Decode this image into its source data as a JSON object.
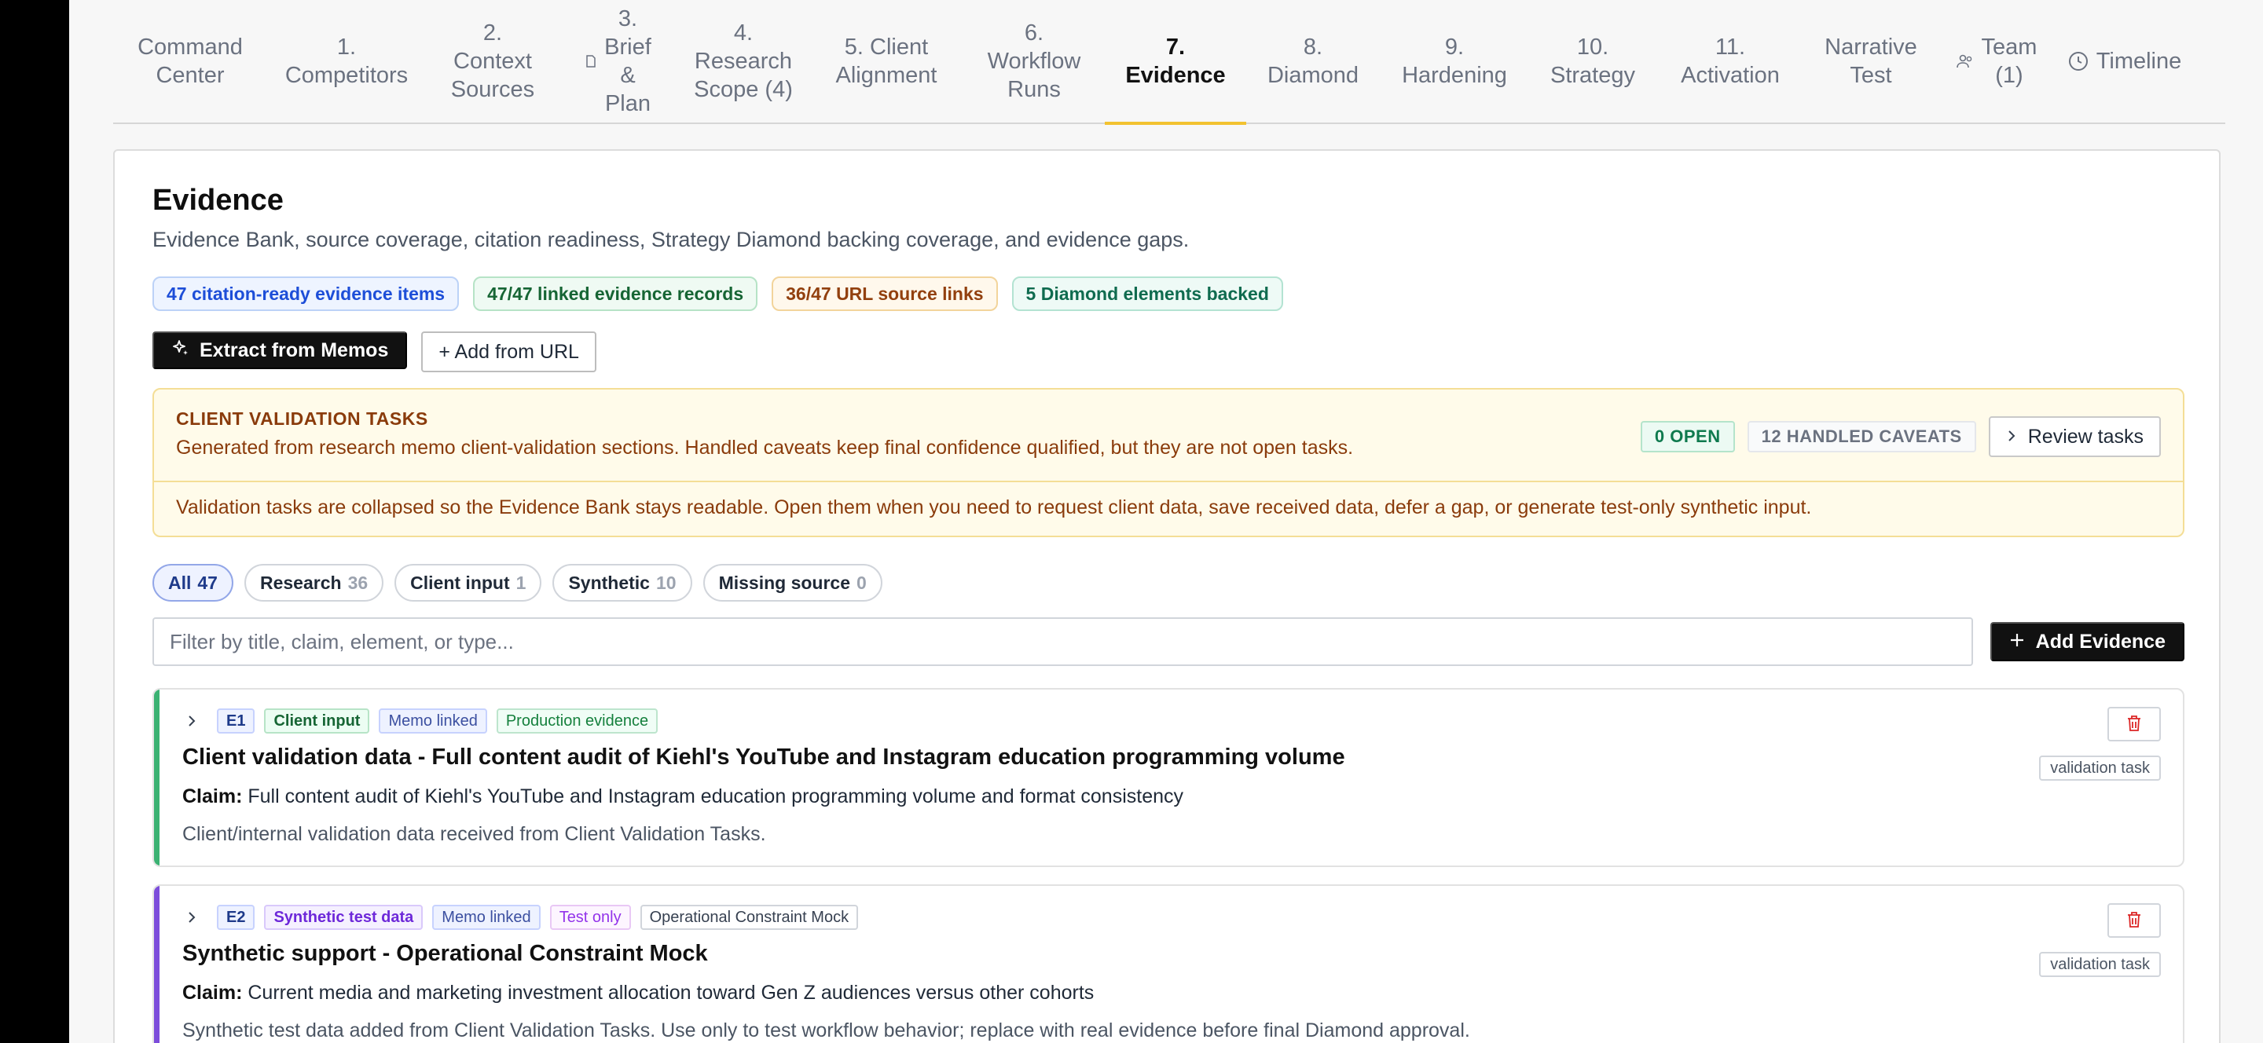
{
  "tabs": [
    {
      "label": "Command\nCenter",
      "icon": ""
    },
    {
      "label": "1.\nCompetitors",
      "icon": ""
    },
    {
      "label": "2.\nContext\nSources",
      "icon": ""
    },
    {
      "label": "3.\nBrief\n&\nPlan",
      "icon": "document-icon"
    },
    {
      "label": "4.\nResearch\nScope (4)",
      "icon": ""
    },
    {
      "label": "5. Client\nAlignment",
      "icon": ""
    },
    {
      "label": "6.\nWorkflow\nRuns",
      "icon": ""
    },
    {
      "label": "7.\nEvidence",
      "icon": "",
      "active": true
    },
    {
      "label": "8.\nDiamond",
      "icon": ""
    },
    {
      "label": "9.\nHardening",
      "icon": ""
    },
    {
      "label": "10.\nStrategy",
      "icon": ""
    },
    {
      "label": "11.\nActivation",
      "icon": ""
    },
    {
      "label": "Narrative\nTest",
      "icon": ""
    },
    {
      "label": "Team\n(1)",
      "icon": "users-icon"
    },
    {
      "label": "Timeline",
      "icon": "clock-icon"
    }
  ],
  "page": {
    "title": "Evidence",
    "subtitle": "Evidence Bank, source coverage, citation readiness, Strategy Diamond backing coverage, and evidence gaps."
  },
  "badges": {
    "citation": "47 citation-ready evidence items",
    "linked": "47/47 linked evidence records",
    "url": "36/47 URL source links",
    "diamond": "5 Diamond elements backed"
  },
  "actions": {
    "extract": "Extract from Memos",
    "add_url": "+ Add from URL"
  },
  "validation": {
    "heading": "CLIENT VALIDATION TASKS",
    "description": "Generated from research memo client-validation sections. Handled caveats keep final confidence qualified, but they are not open tasks.",
    "open": "0 OPEN",
    "handled": "12 HANDLED CAVEATS",
    "review": "Review tasks",
    "note": "Validation tasks are collapsed so the Evidence Bank stays readable. Open them when you need to request client data, save received data, defer a gap, or generate test-only synthetic input."
  },
  "filters": {
    "all": {
      "label": "All",
      "count": "47"
    },
    "research": {
      "label": "Research",
      "count": "36"
    },
    "client": {
      "label": "Client input",
      "count": "1"
    },
    "synthetic": {
      "label": "Synthetic",
      "count": "10"
    },
    "missing": {
      "label": "Missing source",
      "count": "0"
    }
  },
  "search": {
    "placeholder": "Filter by title, claim, element, or type..."
  },
  "add_evidence": "Add Evidence",
  "evidence": [
    {
      "id": "E1",
      "type": "Client input",
      "memo": "Memo linked",
      "extra": "Production evidence",
      "title": "Client validation data - Full content audit of Kiehl's YouTube and Instagram education programming volume",
      "claim_label": "Claim:",
      "claim": "Full content audit of Kiehl's YouTube and Instagram education programming volume and format consistency",
      "note": "Client/internal validation data received from Client Validation Tasks.",
      "task": "validation task",
      "accent": "#3bb273"
    },
    {
      "id": "E2",
      "type": "Synthetic test data",
      "memo": "Memo linked",
      "extra": "Test only",
      "extra2": "Operational Constraint Mock",
      "title": "Synthetic support - Operational Constraint Mock",
      "claim_label": "Claim:",
      "claim": "Current media and marketing investment allocation toward Gen Z audiences versus other cohorts",
      "note": "Synthetic test data added from Client Validation Tasks. Use only to test workflow behavior; replace with real evidence before final Diamond approval.",
      "task": "validation task",
      "accent": "#7c4ddb"
    }
  ]
}
